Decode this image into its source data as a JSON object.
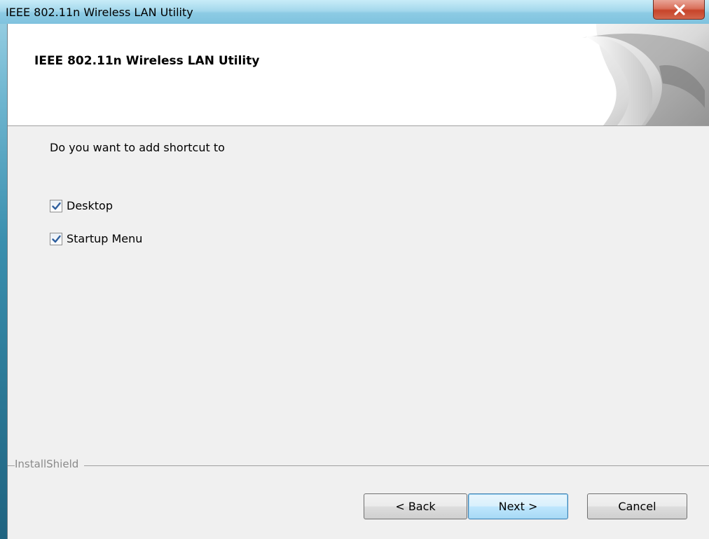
{
  "window": {
    "title": "IEEE 802.11n Wireless LAN Utility",
    "close_icon": "close-x-icon"
  },
  "header": {
    "title": "IEEE 802.11n Wireless LAN Utility",
    "graphic": "page-curl-graphic"
  },
  "content": {
    "prompt": "Do you want to add shortcut to",
    "options": [
      {
        "label": "Desktop",
        "checked": true
      },
      {
        "label": "Startup Menu",
        "checked": true
      }
    ]
  },
  "footer": {
    "brand": "InstallShield",
    "back_label": "< Back",
    "next_label": "Next >",
    "cancel_label": "Cancel"
  },
  "colors": {
    "accent": "#3c7fb1",
    "close_red": "#c7442a",
    "check_blue": "#2e5f9e"
  }
}
